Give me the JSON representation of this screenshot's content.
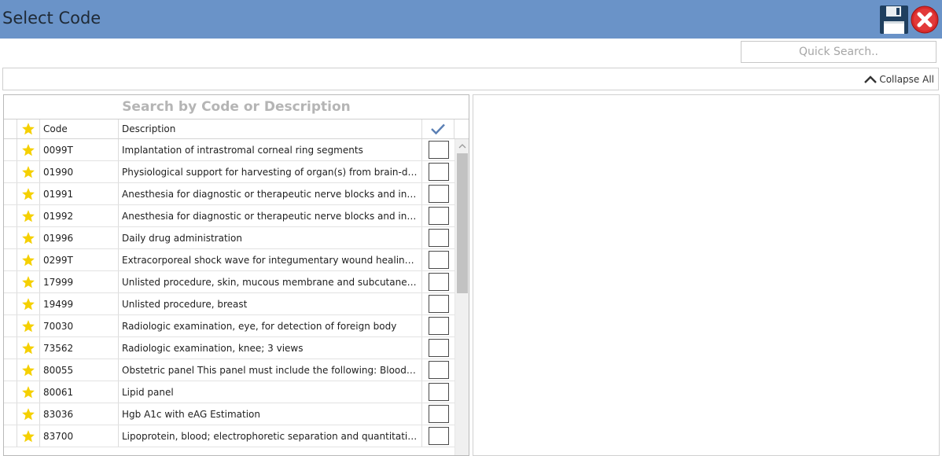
{
  "window": {
    "title": "Select Code",
    "accent_color": "#6a93c8"
  },
  "toolbar": {
    "save_icon": "floppy-disk-icon",
    "close_icon": "red-close-icon"
  },
  "quick_search": {
    "placeholder": "Quick Search..",
    "value": ""
  },
  "collapse_all": {
    "label": "Collapse All",
    "icon": "chevron-up-icon"
  },
  "search_panel": {
    "header": "Search by Code or Description",
    "columns": {
      "favorite_icon": "star-icon",
      "code": "Code",
      "description": "Description",
      "selected_icon": "checkmark-icon"
    },
    "rows": [
      {
        "code": "0099T",
        "description": "Implantation of intrastromal corneal ring segments"
      },
      {
        "code": "01990",
        "description": "Physiological support for harvesting of organ(s) from brain-dead pati..."
      },
      {
        "code": "01991",
        "description": "Anesthesia for diagnostic or therapeutic nerve blocks and injections (..."
      },
      {
        "code": "01992",
        "description": "Anesthesia for diagnostic or therapeutic nerve blocks and injections (..."
      },
      {
        "code": "01996",
        "description": "Daily drug administration"
      },
      {
        "code": "0299T",
        "description": "Extracorporeal shock wave for integumentary wound healing, high en..."
      },
      {
        "code": "17999",
        "description": "Unlisted procedure, skin, mucous membrane and subcutaneous tissue"
      },
      {
        "code": "19499",
        "description": "Unlisted procedure, breast"
      },
      {
        "code": "70030",
        "description": "Radiologic examination, eye, for detection of foreign body"
      },
      {
        "code": "73562",
        "description": "Radiologic examination, knee; 3 views"
      },
      {
        "code": "80055",
        "description": "Obstetric panel This panel must include the following: Blood count, c..."
      },
      {
        "code": "80061",
        "description": "Lipid panel"
      },
      {
        "code": "83036",
        "description": "Hgb A1c with eAG Estimation"
      },
      {
        "code": "83700",
        "description": "Lipoprotein, blood; electrophoretic separation and quantitation"
      }
    ]
  },
  "colors": {
    "star": "#f5d000",
    "check": "#5a7fb4"
  }
}
